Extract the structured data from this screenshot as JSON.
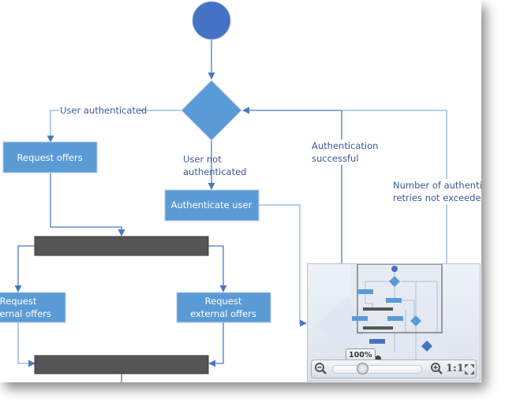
{
  "diagram": {
    "colors": {
      "start_node": "#4472c4",
      "activity": "#5b9bd5",
      "decision": "#5b9bd5",
      "bar": "#555555",
      "connector": "#4a78c0",
      "label": "#3a5a9a"
    },
    "nodes": {
      "request_offers": "Request offers",
      "authenticate_user": "Authenticate user",
      "request_external_left_1": "Request",
      "request_external_left_2": "external offers",
      "request_external_right_1": "Request",
      "request_external_right_2": "external offers"
    },
    "connector_labels": {
      "user_authenticated": "User authenticated",
      "user_not_authenticated_1": "User not",
      "user_not_authenticated_2": "authenticated",
      "auth_successful_1": "Authentication",
      "auth_successful_2": "successful",
      "retries_1": "Number of authentic",
      "retries_2": "retries not exceeded"
    }
  },
  "navigator": {
    "zoom_level": "100%",
    "zoom_fraction": 0.3,
    "zoom_out_icon": "zoom-out-icon",
    "zoom_in_icon": "zoom-in-icon",
    "actual_size_label": "1:1",
    "fit_icon": "fit-to-screen-icon"
  }
}
